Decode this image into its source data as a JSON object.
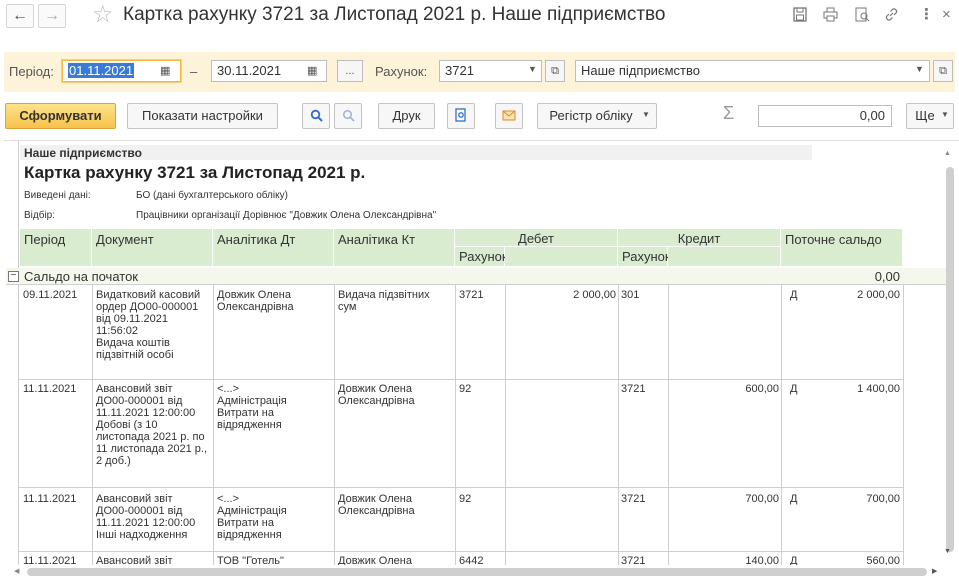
{
  "window": {
    "title": "Картка рахунку 3721 за Листопад 2021 р. Наше підприємство",
    "back_icon": "←",
    "forward_icon": "→",
    "star_icon": "☆"
  },
  "filters": {
    "period_label": "Період:",
    "period_from": "01.11.2021",
    "dash": "–",
    "period_to": "30.11.2021",
    "ellipsis": "...",
    "account_label": "Рахунок:",
    "account_value": "3721",
    "organization_value": "Наше підприємство"
  },
  "toolbar": {
    "generate_label": "Сформувати",
    "show_settings_label": "Показати настройки",
    "print_label": "Друк",
    "register_label": "Регістр обліку",
    "sigma": "Σ",
    "sum_value": "0,00",
    "more_label": "Ще"
  },
  "report": {
    "org_name": "Наше підприємство",
    "title": "Картка рахунку 3721 за Листопад 2021 р.",
    "data_label": "Виведені дані:",
    "data_value": "БО (дані бухгалтерського обліку)",
    "filter_label": "Відбір:",
    "filter_value": "Працівники організації Дорівнює \"Довжик Олена Олександрівна\"",
    "columns": {
      "period": "Період",
      "document": "Документ",
      "analytics_dt": "Аналітика Дт",
      "analytics_kt": "Аналітика Кт",
      "debit": "Дебет",
      "credit": "Кредит",
      "balance": "Поточне сальдо",
      "account": "Рахунок"
    },
    "opening": {
      "label": "Сальдо на початок",
      "value": "0,00"
    },
    "rows": [
      {
        "period": "09.11.2021",
        "document": "Видатковий касовий\nордер ДО00-000001\nвід 09.11.2021\n11:56:02\nВидача коштів\nпідзвітній особі",
        "dt": "Довжик Олена\nОлександрівна",
        "kt": "Видача підзвітних\nсум",
        "debit_acc": "3721",
        "debit_sum": "2 000,00",
        "credit_acc": "301",
        "credit_sum": "",
        "bal_type": "Д",
        "balance": "2 000,00"
      },
      {
        "period": "11.11.2021",
        "document": "Авансовий звіт\nДО00-000001 від\n11.11.2021 12:00:00\nДобові (з 10\nлистопада 2021 р. по\n11 листопада 2021 р.,\n2 доб.)",
        "dt": "<...>\nАдміністрація\nВитрати на\nвідрядження",
        "kt": "Довжик Олена\nОлександрівна",
        "debit_acc": "92",
        "debit_sum": "",
        "credit_acc": "3721",
        "credit_sum": "600,00",
        "bal_type": "Д",
        "balance": "1 400,00"
      },
      {
        "period": "11.11.2021",
        "document": "Авансовий звіт\nДО00-000001 від\n11.11.2021 12:00:00\nІнші надходження",
        "dt": "<...>\nАдміністрація\nВитрати на\nвідрядження",
        "kt": "Довжик Олена\nОлександрівна",
        "debit_acc": "92",
        "debit_sum": "",
        "credit_acc": "3721",
        "credit_sum": "700,00",
        "bal_type": "Д",
        "balance": "700,00"
      },
      {
        "period": "11.11.2021",
        "document": "Авансовий звіт",
        "dt": "ТОВ \"Готель\"",
        "kt": "Довжик Олена",
        "debit_acc": "6442",
        "debit_sum": "",
        "credit_acc": "3721",
        "credit_sum": "140,00",
        "bal_type": "Д",
        "balance": "560,00"
      }
    ]
  }
}
